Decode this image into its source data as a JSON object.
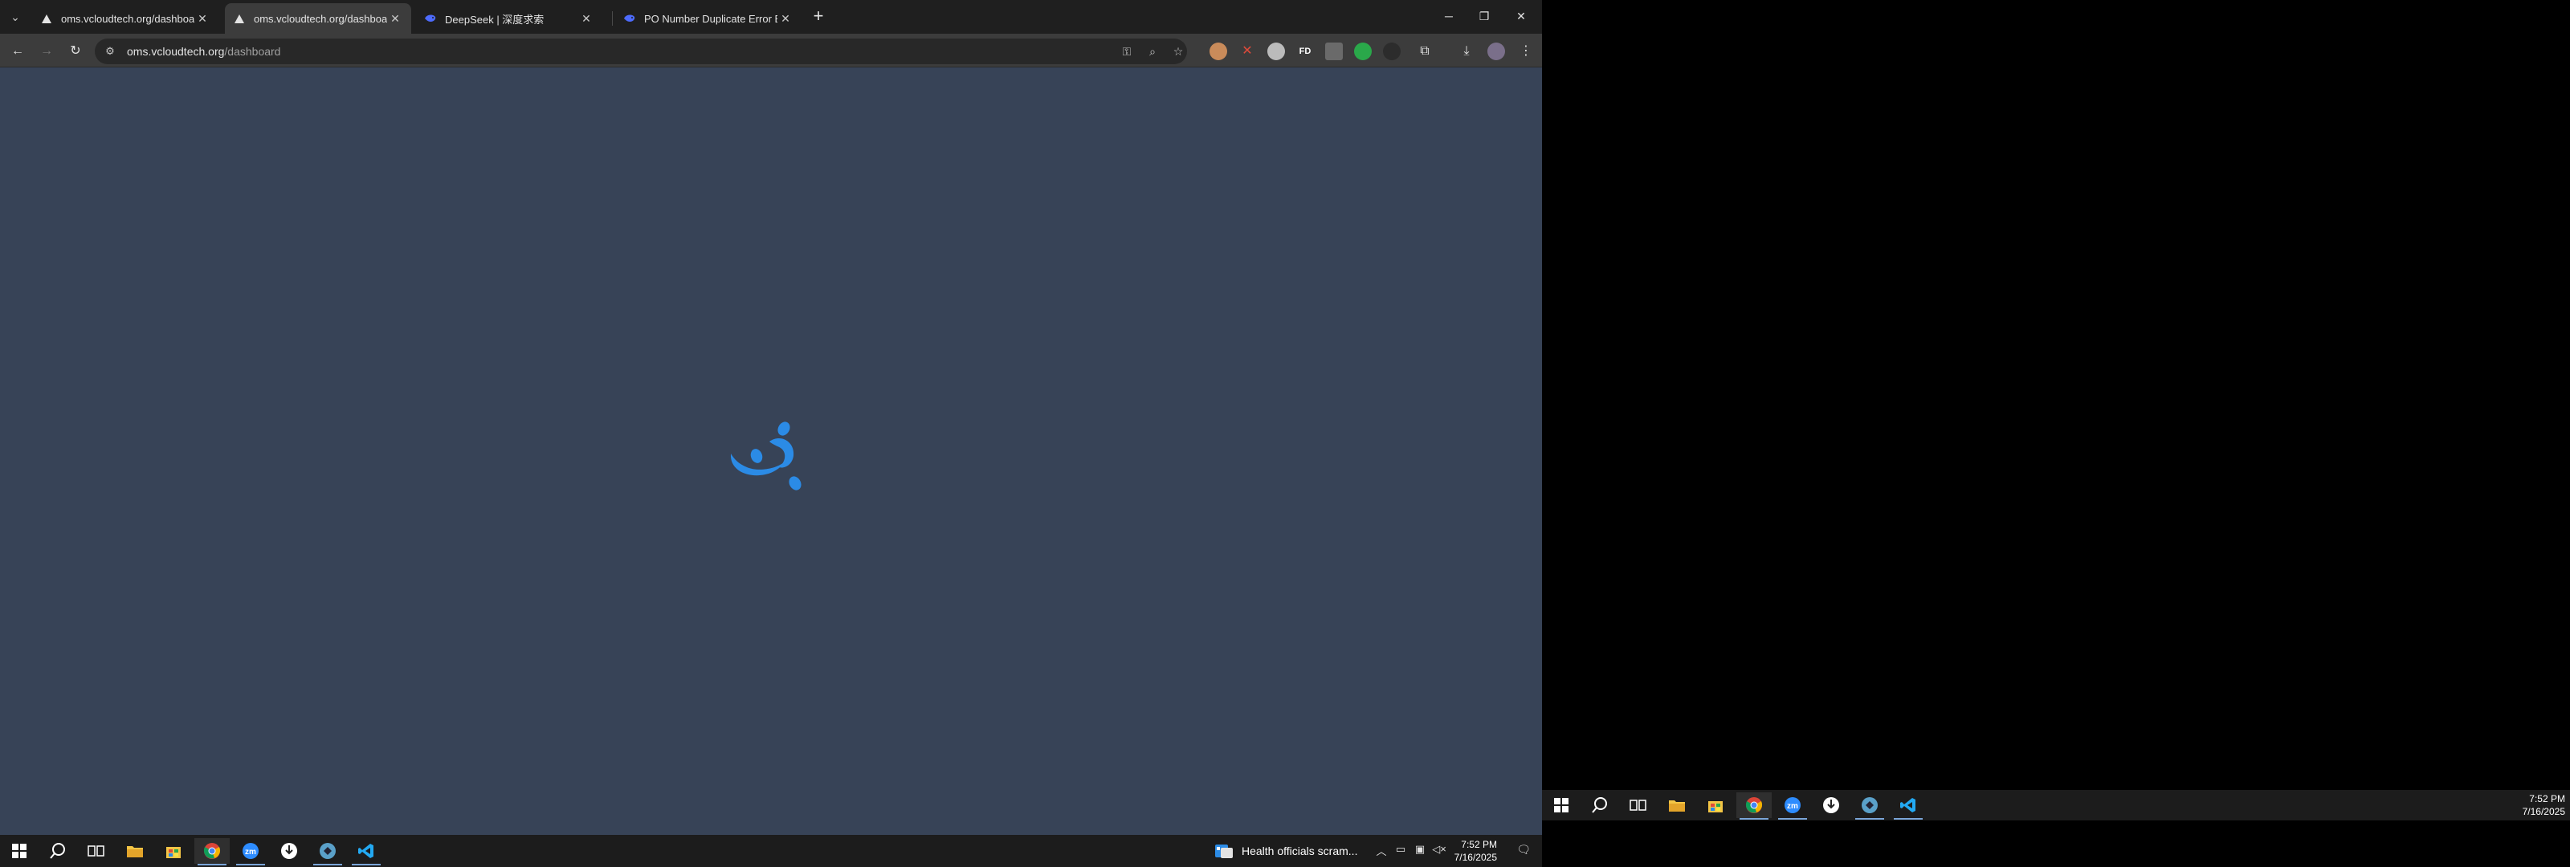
{
  "browser": {
    "tabs": [
      {
        "title": "oms.vcloudtech.org/dashboard",
        "close": "✕"
      },
      {
        "title": "oms.vcloudtech.org/dashboard",
        "close": "✕"
      },
      {
        "title": "DeepSeek | 深度求索",
        "close": "✕"
      },
      {
        "title": "PO Number Duplicate Error Exp",
        "close": "✕"
      }
    ],
    "active_tab": 1,
    "new_tab": "+",
    "url_host": "oms.vcloudtech.org",
    "url_path": "/dashboard",
    "extensions": [
      "FD"
    ]
  },
  "page": {
    "background": "#374357",
    "spinner_color": "#2b8be6"
  },
  "taskbar": {
    "news_text": "Health officials scram...",
    "time": "7:52 PM",
    "date": "7/16/2025"
  },
  "taskbar_secondary": {
    "time": "7:52 PM",
    "date": "7/16/2025"
  }
}
